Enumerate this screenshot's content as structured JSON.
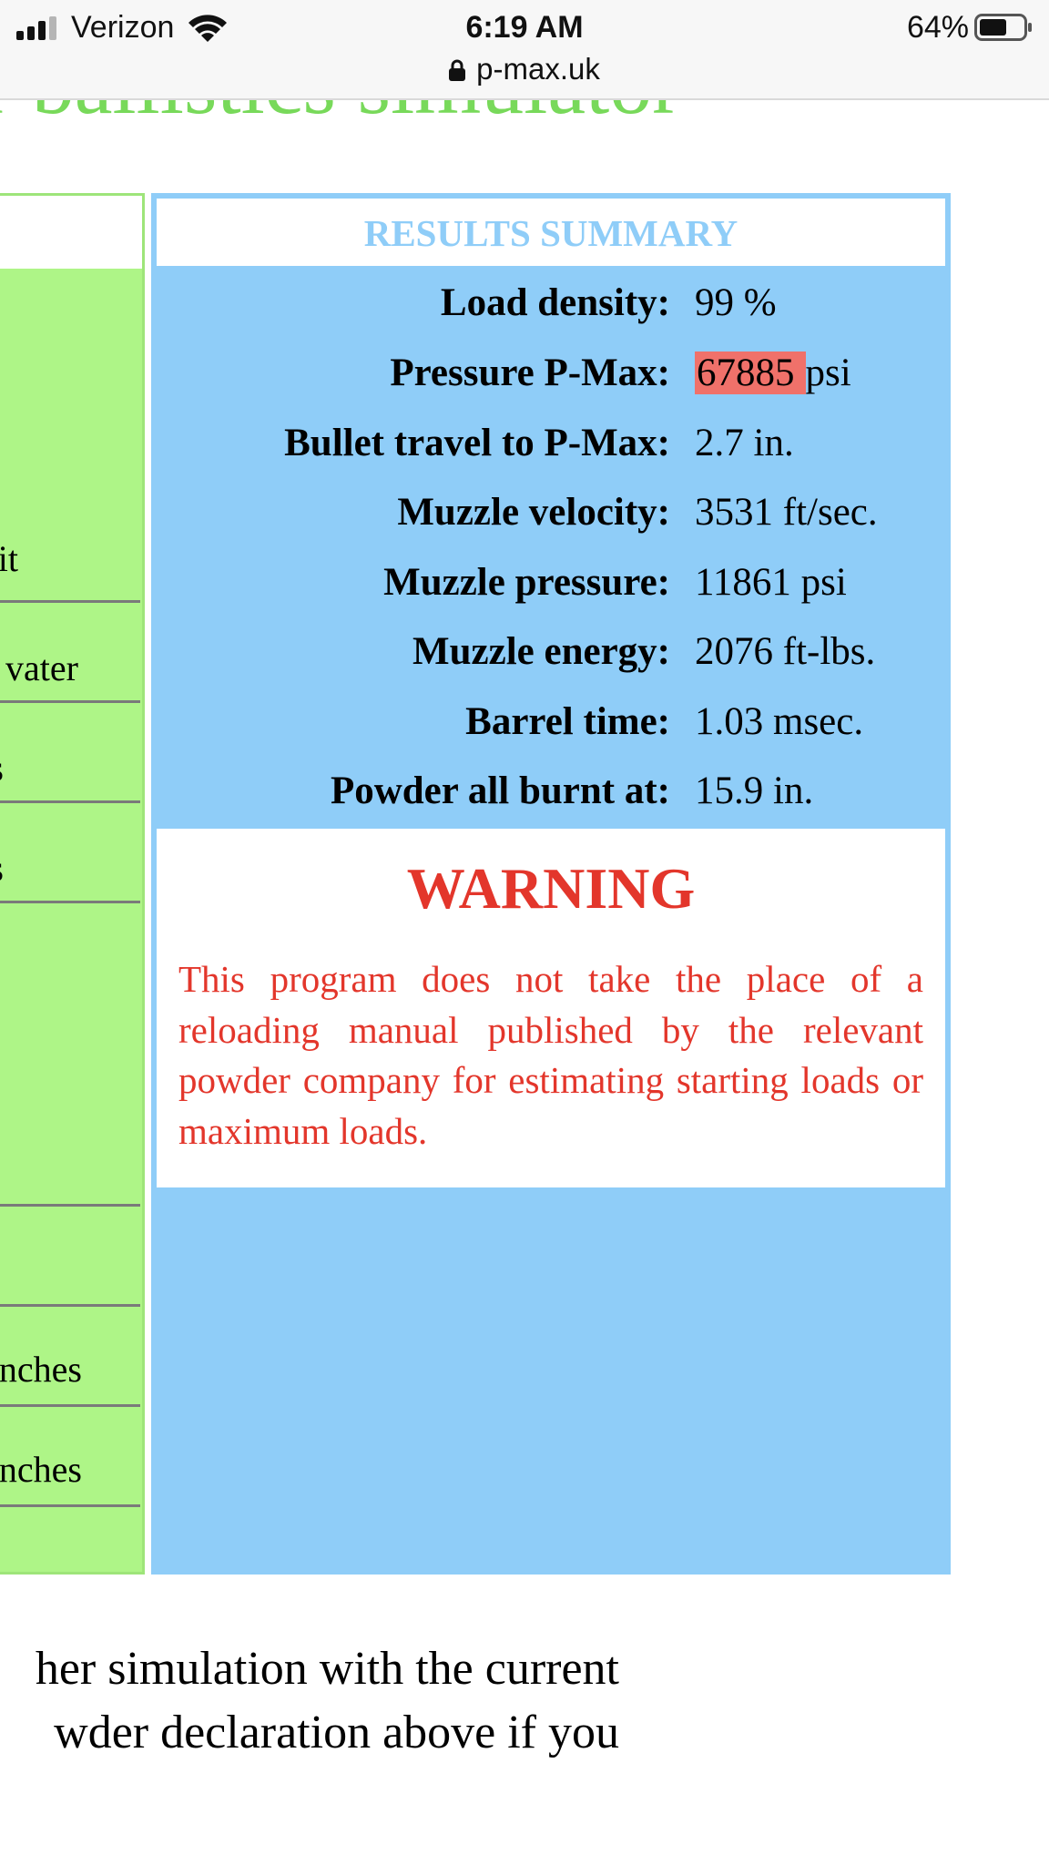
{
  "status_bar": {
    "carrier": "Verizon",
    "time": "6:19 AM",
    "url": "p-max.uk",
    "battery": "64%",
    "battery_level": 0.64,
    "icons": [
      "signal-icon",
      "wifi-icon",
      "lock-icon",
      "battery-icon"
    ]
  },
  "page": {
    "heading": "r ballistics simulator"
  },
  "left_panel": {
    "rows": [
      "it",
      "vater",
      "s",
      "s",
      "",
      "",
      "nches",
      "nches"
    ]
  },
  "results": {
    "title": "RESULTS SUMMARY",
    "rows": [
      {
        "label": "Load density:",
        "value": "99 %"
      },
      {
        "label": "Pressure P-Max:",
        "value": "67885",
        "unit": "psi"
      },
      {
        "label": "Bullet travel to P-Max:",
        "value": "2.7 in."
      },
      {
        "label": "Muzzle velocity:",
        "value": "3531 ft/sec."
      },
      {
        "label": "Muzzle pressure:",
        "value": "11861 psi"
      },
      {
        "label": "Muzzle energy:",
        "value": "2076 ft-lbs."
      },
      {
        "label": "Barrel time:",
        "value": "1.03 msec."
      },
      {
        "label": "Powder all burnt at:",
        "value": "15.9 in."
      }
    ],
    "warning_title": "WARNING",
    "warning_text": "This program does not take the place of a reloading manual published by the relevant powder company for estimating starting loads or maximum loads."
  },
  "footer": {
    "line1": "her simulation with the current",
    "line2": "wder declaration above if you"
  },
  "colors": {
    "green_panel": "#aef587",
    "blue_panel": "#8fcdf8",
    "warning_red": "#e3362b",
    "highlight": "#f0716a",
    "heading_green": "#78d95a"
  }
}
